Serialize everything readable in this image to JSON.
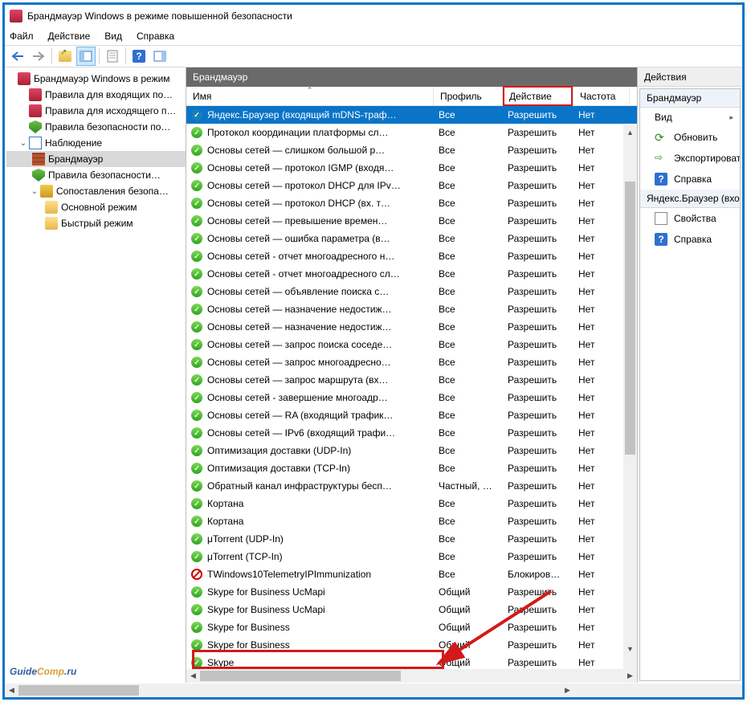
{
  "window": {
    "title": "Брандмауэр Windows в режиме повышенной безопасности"
  },
  "menu": {
    "file": "Файл",
    "action": "Действие",
    "view": "Вид",
    "help": "Справка"
  },
  "tree": {
    "root": "Брандмауэр Windows в режим",
    "inbound": "Правила для входящих по…",
    "outbound": "Правила для исходящего п…",
    "consec": "Правила безопасности по…",
    "monitoring": "Наблюдение",
    "firewall": "Брандмауэр",
    "consec2": "Правила безопасности…",
    "safety": "Сопоставления безопа…",
    "main_mode": "Основной режим",
    "quick_mode": "Быстрый режим"
  },
  "mid": {
    "header": "Брандмауэр",
    "cols": {
      "name": "Имя",
      "profile": "Профиль",
      "action": "Действие",
      "freq": "Частота"
    }
  },
  "rules": [
    {
      "icon": "ok",
      "name": "Skype",
      "profile": "Общий",
      "action": "Разрешить",
      "freq": "Нет"
    },
    {
      "icon": "ok",
      "name": "Skype for Business",
      "profile": "Общий",
      "action": "Разрешить",
      "freq": "Нет"
    },
    {
      "icon": "ok",
      "name": "Skype for Business",
      "profile": "Общий",
      "action": "Разрешить",
      "freq": "Нет"
    },
    {
      "icon": "ok",
      "name": "Skype for Business UcMapi",
      "profile": "Общий",
      "action": "Разрешить",
      "freq": "Нет"
    },
    {
      "icon": "ok",
      "name": "Skype for Business UcMapi",
      "profile": "Общий",
      "action": "Разрешить",
      "freq": "Нет"
    },
    {
      "icon": "blk",
      "name": "TWindows10TelemetryIPImmunization",
      "profile": "Все",
      "action": "Блокиров…",
      "freq": "Нет"
    },
    {
      "icon": "ok",
      "name": "μTorrent (TCP-In)",
      "profile": "Все",
      "action": "Разрешить",
      "freq": "Нет"
    },
    {
      "icon": "ok",
      "name": "μTorrent (UDP-In)",
      "profile": "Все",
      "action": "Разрешить",
      "freq": "Нет"
    },
    {
      "icon": "ok",
      "name": "Кортана",
      "profile": "Все",
      "action": "Разрешить",
      "freq": "Нет"
    },
    {
      "icon": "ok",
      "name": "Кортана",
      "profile": "Все",
      "action": "Разрешить",
      "freq": "Нет"
    },
    {
      "icon": "ok",
      "name": "Обратный канал инфраструктуры бесп…",
      "profile": "Частный, …",
      "action": "Разрешить",
      "freq": "Нет"
    },
    {
      "icon": "ok",
      "name": "Оптимизация доставки (TCP-In)",
      "profile": "Все",
      "action": "Разрешить",
      "freq": "Нет"
    },
    {
      "icon": "ok",
      "name": "Оптимизация доставки (UDP-In)",
      "profile": "Все",
      "action": "Разрешить",
      "freq": "Нет"
    },
    {
      "icon": "ok",
      "name": "Основы сетей — IPv6 (входящий трафи…",
      "profile": "Все",
      "action": "Разрешить",
      "freq": "Нет"
    },
    {
      "icon": "ok",
      "name": "Основы сетей — RA (входящий трафик…",
      "profile": "Все",
      "action": "Разрешить",
      "freq": "Нет"
    },
    {
      "icon": "ok",
      "name": "Основы сетей - завершение многоадр…",
      "profile": "Все",
      "action": "Разрешить",
      "freq": "Нет"
    },
    {
      "icon": "ok",
      "name": "Основы сетей — запрос маршрута (вх…",
      "profile": "Все",
      "action": "Разрешить",
      "freq": "Нет"
    },
    {
      "icon": "ok",
      "name": "Основы сетей — запрос многоадресно…",
      "profile": "Все",
      "action": "Разрешить",
      "freq": "Нет"
    },
    {
      "icon": "ok",
      "name": "Основы сетей — запрос поиска соседе…",
      "profile": "Все",
      "action": "Разрешить",
      "freq": "Нет"
    },
    {
      "icon": "ok",
      "name": "Основы сетей — назначение недостиж…",
      "profile": "Все",
      "action": "Разрешить",
      "freq": "Нет"
    },
    {
      "icon": "ok",
      "name": "Основы сетей — назначение недостиж…",
      "profile": "Все",
      "action": "Разрешить",
      "freq": "Нет"
    },
    {
      "icon": "ok",
      "name": "Основы сетей — объявление поиска с…",
      "profile": "Все",
      "action": "Разрешить",
      "freq": "Нет"
    },
    {
      "icon": "ok",
      "name": "Основы сетей - отчет многоадресного сл…",
      "profile": "Все",
      "action": "Разрешить",
      "freq": "Нет"
    },
    {
      "icon": "ok",
      "name": "Основы сетей - отчет многоадресного н…",
      "profile": "Все",
      "action": "Разрешить",
      "freq": "Нет"
    },
    {
      "icon": "ok",
      "name": "Основы сетей — ошибка параметра (в…",
      "profile": "Все",
      "action": "Разрешить",
      "freq": "Нет"
    },
    {
      "icon": "ok",
      "name": "Основы сетей — превышение времен…",
      "profile": "Все",
      "action": "Разрешить",
      "freq": "Нет"
    },
    {
      "icon": "ok",
      "name": "Основы сетей — протокол DHCP (вх. т…",
      "profile": "Все",
      "action": "Разрешить",
      "freq": "Нет"
    },
    {
      "icon": "ok",
      "name": "Основы сетей — протокол DHCP для IPv…",
      "profile": "Все",
      "action": "Разрешить",
      "freq": "Нет"
    },
    {
      "icon": "ok",
      "name": "Основы сетей — протокол IGMP (входя…",
      "profile": "Все",
      "action": "Разрешить",
      "freq": "Нет"
    },
    {
      "icon": "ok",
      "name": "Основы сетей — слишком большой р…",
      "profile": "Все",
      "action": "Разрешить",
      "freq": "Нет"
    },
    {
      "icon": "ok",
      "name": "Протокол координации платформы сл…",
      "profile": "Все",
      "action": "Разрешить",
      "freq": "Нет"
    },
    {
      "icon": "ysel",
      "name": "Яндекс.Браузер (входящий mDNS-траф…",
      "profile": "Все",
      "action": "Разрешить",
      "freq": "Нет",
      "selected": true
    }
  ],
  "actions": {
    "header": "Действия",
    "sec1": "Брандмауэр",
    "view": "Вид",
    "refresh": "Обновить",
    "export": "Экспортироват",
    "help": "Справка",
    "sec2": "Яндекс.Браузер (вхо",
    "props": "Свойства",
    "help2": "Справка"
  },
  "watermark": {
    "g": "Guide",
    "c": "Comp",
    "tail": ".ru"
  }
}
